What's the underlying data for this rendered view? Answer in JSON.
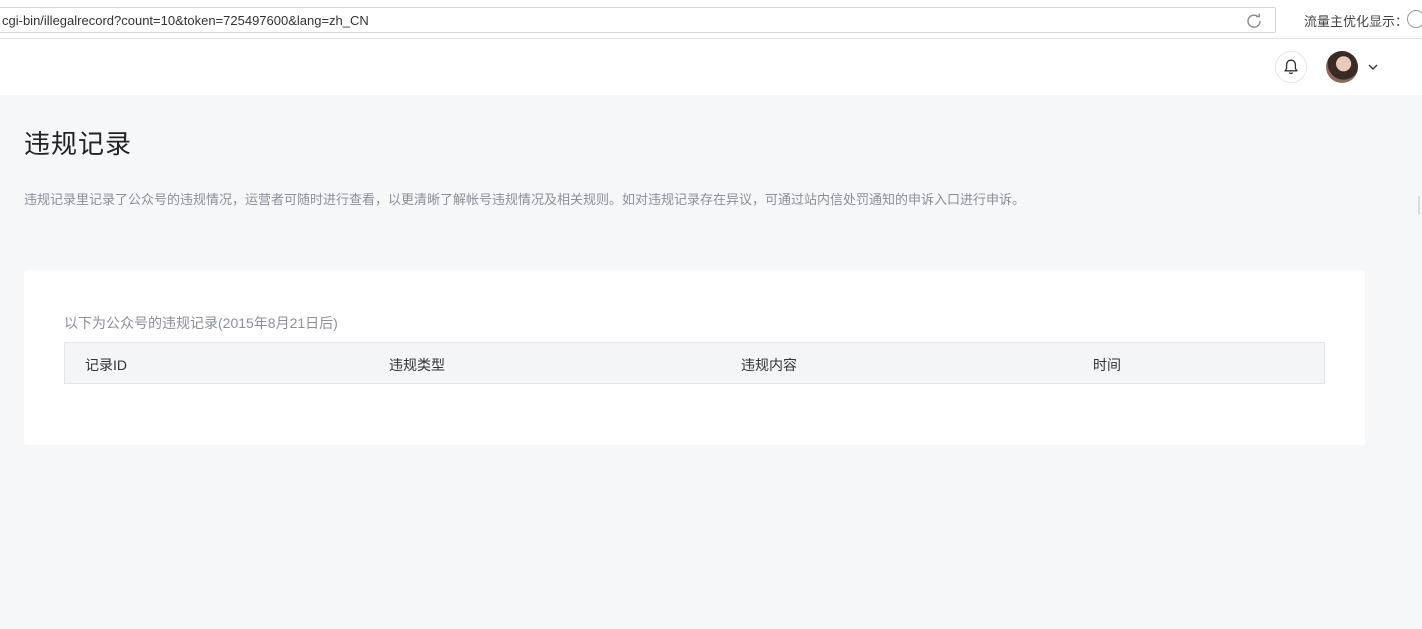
{
  "browser": {
    "url": "cgi-bin/illegalrecord?count=10&token=725497600&lang=zh_CN",
    "extension_label": "流量主优化显示："
  },
  "topnav": {
    "bell_icon": "bell-icon",
    "caret_icon": "chevron-down-icon"
  },
  "page": {
    "title": "违规记录",
    "description": "违规记录里记录了公众号的违规情况，运营者可随时进行查看，以更清晰了解帐号违规情况及相关规则。如对违规记录存在异议，可通过站内信处罚通知的申诉入口进行申诉。"
  },
  "records": {
    "subtitle": "以下为公众号的违规记录(2015年8月21日后)",
    "columns": [
      "记录ID",
      "违规类型",
      "违规内容",
      "时间"
    ],
    "rows": []
  },
  "colors": {
    "background": "#f6f7f9",
    "card": "#ffffff",
    "table_header": "#f4f5f7",
    "muted_text": "#8a8f99"
  }
}
